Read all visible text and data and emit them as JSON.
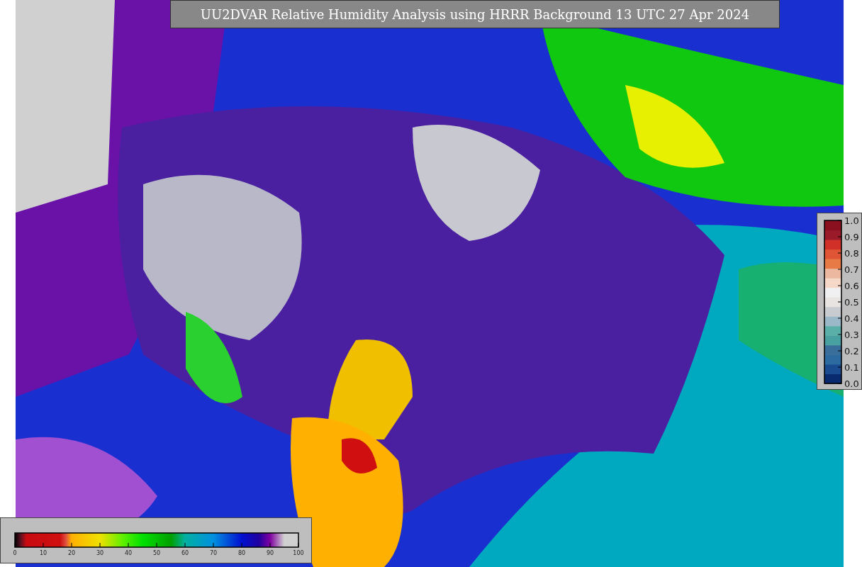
{
  "title": "UU2DVAR Relative Humidity Analysis using HRRR Background 13 UTC 27 Apr 2024",
  "humidity_colorbar": {
    "ticks": [
      "0",
      "10",
      "20",
      "30",
      "40",
      "50",
      "60",
      "70",
      "80",
      "90",
      "100"
    ]
  },
  "station_colorbar": {
    "ticks": [
      "1.0",
      "0.9",
      "0.8",
      "0.7",
      "0.6",
      "0.5",
      "0.4",
      "0.3",
      "0.2",
      "0.1",
      "0.0"
    ]
  }
}
